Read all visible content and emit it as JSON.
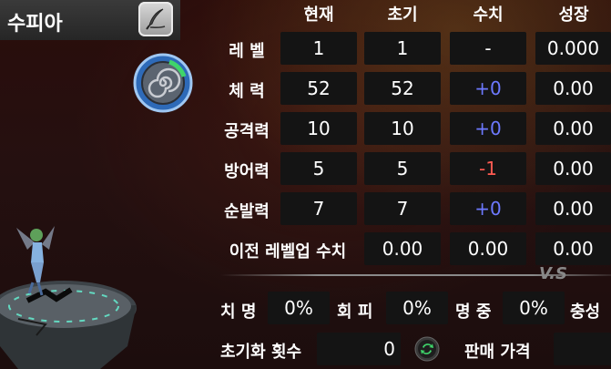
{
  "character": {
    "name": "수피아"
  },
  "headers": {
    "current": "현재",
    "initial": "초기",
    "stat": "수치",
    "growth": "성장"
  },
  "stats": [
    {
      "label": "레 벨",
      "current": "1",
      "initial": "1",
      "value": "-",
      "growth": "0.000",
      "value_type": "neutral"
    },
    {
      "label": "체 력",
      "current": "52",
      "initial": "52",
      "value": "+0",
      "growth": "0.00",
      "value_type": "positive"
    },
    {
      "label": "공격력",
      "current": "10",
      "initial": "10",
      "value": "+0",
      "growth": "0.00",
      "value_type": "positive"
    },
    {
      "label": "방어력",
      "current": "5",
      "initial": "5",
      "value": "-1",
      "growth": "0.00",
      "value_type": "negative"
    },
    {
      "label": "순발력",
      "current": "7",
      "initial": "7",
      "value": "+0",
      "growth": "0.00",
      "value_type": "positive"
    }
  ],
  "prev_levelup": {
    "label": "이전 레벨업 수치",
    "v1": "0.00",
    "v2": "0.00",
    "v3": "0.00"
  },
  "vs_text": "V.S",
  "combat": {
    "crit": {
      "label": "치 명",
      "value": "0%"
    },
    "evade": {
      "label": "회 피",
      "value": "0%"
    },
    "accuracy": {
      "label": "명 중",
      "value": "0%"
    },
    "loyalty_label": "충성"
  },
  "reset": {
    "label": "초기화 횟수",
    "value": "0"
  },
  "sell": {
    "label": "판매 가격",
    "value": ""
  },
  "colors": {
    "positive": "#6d79ff",
    "negative": "#ff5a52",
    "cell_bg": "#141414"
  },
  "icons": {
    "edit": "feather-pen-icon",
    "emblem": "spiral-element-emblem-icon",
    "reset": "refresh-arrows-icon"
  }
}
